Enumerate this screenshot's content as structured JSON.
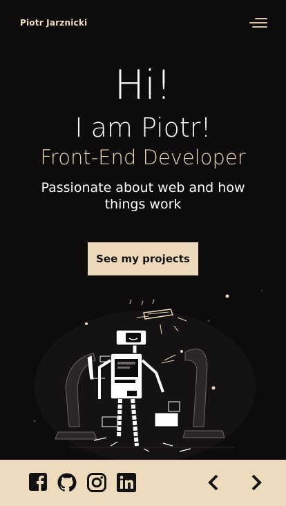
{
  "header": {
    "brand": "Piotr Jarznicki",
    "menu_icon": "hamburger-menu-icon"
  },
  "hero": {
    "greeting": "Hi!",
    "intro": "I am Piotr!",
    "role": "Front-End Developer",
    "tagline": "Passionate about web and how things work",
    "cta_label": "See my projects"
  },
  "illustration": {
    "name": "robot-illustration"
  },
  "footer": {
    "social": [
      "facebook-icon",
      "github-icon",
      "instagram-icon",
      "linkedin-icon"
    ],
    "nav": [
      "chevron-left-icon",
      "chevron-right-icon"
    ]
  },
  "colors": {
    "background": "#0d0b0c",
    "accent": "#ecd9b9",
    "text": "#ffffff"
  }
}
